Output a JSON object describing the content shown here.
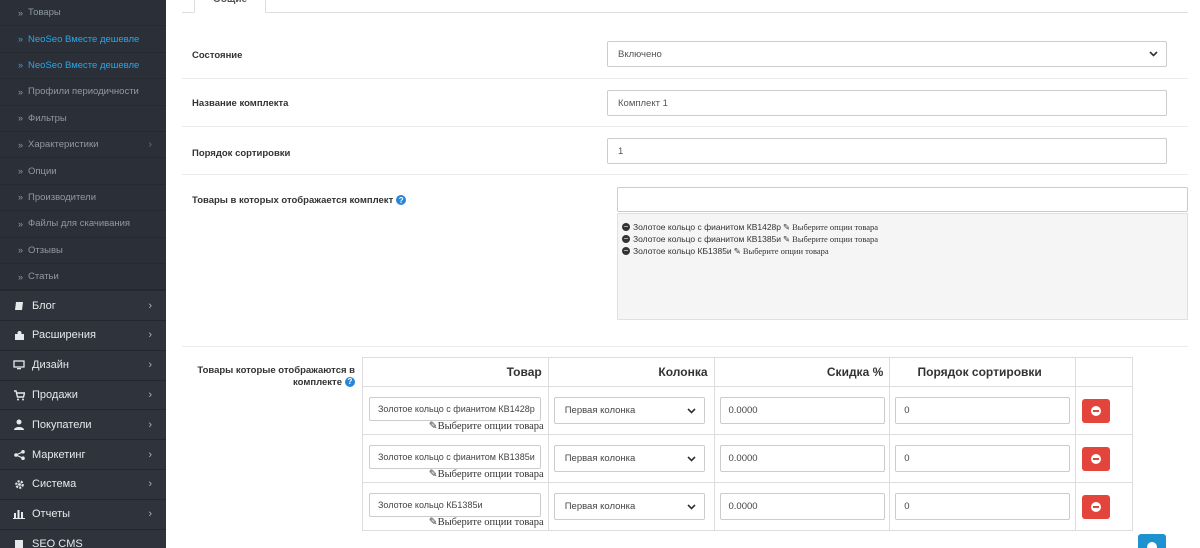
{
  "sidebar": {
    "sub_items": [
      {
        "label": "Товары",
        "active": false,
        "chevron": false
      },
      {
        "label": "NeoSeo Вместе дешевле",
        "active": true,
        "chevron": false
      },
      {
        "label": "NeoSeo Вместе дешевле",
        "active": true,
        "chevron": false
      },
      {
        "label": "Профили периодичности",
        "active": false,
        "chevron": false
      },
      {
        "label": "Фильтры",
        "active": false,
        "chevron": false
      },
      {
        "label": "Характеристики",
        "active": false,
        "chevron": true
      },
      {
        "label": "Опции",
        "active": false,
        "chevron": false
      },
      {
        "label": "Производители",
        "active": false,
        "chevron": false
      },
      {
        "label": "Файлы для скачивания",
        "active": false,
        "chevron": false
      },
      {
        "label": "Отзывы",
        "active": false,
        "chevron": false
      },
      {
        "label": "Статьи",
        "active": false,
        "chevron": false
      }
    ],
    "main_items": [
      {
        "label": "Блог",
        "icon": "book-icon"
      },
      {
        "label": "Расширения",
        "icon": "puzzle-icon"
      },
      {
        "label": "Дизайн",
        "icon": "monitor-icon"
      },
      {
        "label": "Продажи",
        "icon": "cart-icon"
      },
      {
        "label": "Покупатели",
        "icon": "user-icon"
      },
      {
        "label": "Маркетинг",
        "icon": "share-icon"
      },
      {
        "label": "Система",
        "icon": "gear-icon"
      },
      {
        "label": "Отчеты",
        "icon": "bar-chart-icon"
      },
      {
        "label": "SEO CMS",
        "icon": "document-icon"
      }
    ],
    "raquo": "»",
    "chevron": "›"
  },
  "tabs": {
    "general": "Общие"
  },
  "form": {
    "status_label": "Состояние",
    "status_value": "Включено",
    "name_label": "Название комплекта",
    "name_value": "Комплект 1",
    "sort_label": "Порядок сортировки",
    "sort_value": "1",
    "products_label": "Товары в которых отображается комплект",
    "products_search_value": "",
    "help_glyph": "?",
    "products_list": [
      {
        "name": "Золотое кольцо с фианитом КВ1428р",
        "options": "Выберите опции товара"
      },
      {
        "name": "Золотое кольцо с фианитом КВ1385и",
        "options": "Выберите опции товара"
      },
      {
        "name": "Золотое кольцо КБ1385и",
        "options": "Выберите опции товара"
      }
    ]
  },
  "bundle": {
    "label": "Товары которые отображаются в комплекте",
    "headers": {
      "product": "Товар",
      "column": "Колонка",
      "discount": "Скидка %",
      "sort": "Порядок сортировки"
    },
    "rows": [
      {
        "product": "Золотое кольцо с фианитом КВ1428р",
        "options": "Выберите опции товара",
        "column": "Первая колонка",
        "discount": "0.0000",
        "sort": "0"
      },
      {
        "product": "Золотое кольцо с фианитом КВ1385и",
        "options": "Выберите опции товара",
        "column": "Первая колонка",
        "discount": "0.0000",
        "sort": "0"
      },
      {
        "product": "Золотое кольцо  КБ1385и",
        "options": "Выберите опции товара",
        "column": "Первая колонка",
        "discount": "0.0000",
        "sort": "0"
      }
    ]
  },
  "colors": {
    "sidebar_bg": "#2b3038",
    "active_link": "#2aa7e6",
    "danger": "#e3443b",
    "primary": "#1e91cf"
  }
}
